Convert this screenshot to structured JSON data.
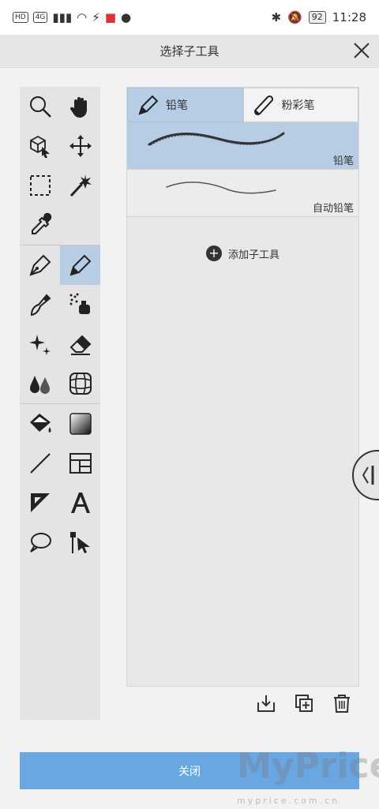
{
  "status_bar": {
    "left_badges": [
      "HD",
      "4G"
    ],
    "time": "11:28",
    "battery": "92"
  },
  "header": {
    "title": "选择子工具"
  },
  "sub_tool_panel": {
    "group_tabs": [
      {
        "label": "铅笔",
        "active": true
      },
      {
        "label": "粉彩笔",
        "active": false
      }
    ],
    "brushes": [
      {
        "label": "铅笔",
        "selected": true
      },
      {
        "label": "自动铅笔",
        "selected": false
      }
    ],
    "add_label": "添加子工具"
  },
  "footer": {
    "close_label": "关闭"
  },
  "watermark": {
    "main": "MyPrice",
    "sub": "myprice.com.cn"
  },
  "colors": {
    "accent": "#69a7e3",
    "selected": "#b7cde4"
  }
}
